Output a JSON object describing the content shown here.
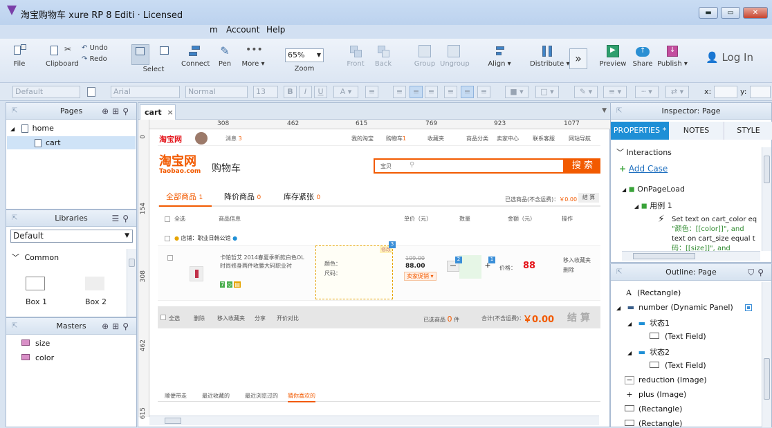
{
  "window": {
    "title": "淘宝购物车    xure RP     8         Editi     ·  Licensed",
    "controls": {
      "minimize": "▬",
      "maximize": "▭",
      "close": "✕"
    }
  },
  "menu": {
    "items": [
      "m",
      "Account",
      "Help"
    ]
  },
  "toolbar": {
    "file": "File",
    "clipboard": "Clipboard",
    "undo": "Undo",
    "redo": "Redo",
    "select": "Select",
    "connect": "Connect",
    "pen": "Pen",
    "more": "More",
    "zoom_value": "65%",
    "zoom": "Zoom",
    "front": "Front",
    "back": "Back",
    "group": "Group",
    "ungroup": "Ungroup",
    "align": "Align",
    "distribute": "Distribute",
    "preview": "Preview",
    "share": "Share",
    "publish": "Publish",
    "login": "Log In"
  },
  "format": {
    "style": "Default",
    "font": "Arial",
    "weight": "Normal",
    "size": "13",
    "x_label": "x:",
    "y_label": "y:"
  },
  "pages": {
    "title": "Pages",
    "items": [
      {
        "label": "home"
      },
      {
        "label": "cart"
      }
    ]
  },
  "libraries": {
    "title": "Libraries",
    "selected": "Default",
    "group": "Common",
    "items": [
      "Box 1",
      "Box 2"
    ]
  },
  "masters": {
    "title": "Masters",
    "items": [
      "size",
      "color"
    ]
  },
  "canvas": {
    "tab": "cart",
    "ruler_h": [
      "308",
      "462",
      "615",
      "769",
      "923",
      "1077"
    ],
    "ruler_v": [
      "0",
      "154",
      "308",
      "462",
      "615"
    ]
  },
  "design": {
    "logo": "淘宝网",
    "topbar": {
      "msg": "消息",
      "msg_count": "3",
      "links": [
        "我的淘宝",
        "购物车",
        "收藏夹",
        "商品分类",
        "卖家中心",
        "联系客服",
        "网站导航"
      ],
      "cart_count": "1"
    },
    "brand": {
      "name": "淘宝网",
      "sub": "Taobao.com",
      "page": "购物车"
    },
    "search": {
      "scope": "宝贝",
      "button": "搜 索"
    },
    "tabs": [
      {
        "label": "全部商品",
        "count": "1"
      },
      {
        "label": "降价商品",
        "count": "0"
      },
      {
        "label": "库存紧张",
        "count": "0"
      }
    ],
    "selected_info": {
      "label": "已选商品(不含运费)",
      "price": "￥0.00",
      "settle": "结 算"
    },
    "columns": [
      "全选",
      "商品信息",
      "单价（元）",
      "数量",
      "金额（元）",
      "操作"
    ],
    "shop": {
      "label": "店铺：",
      "name": "职业日韩公馆"
    },
    "item": {
      "title": "卡帕哲艾 2014春夏季新款白色OL时尚修身两件收腰大码职业衬",
      "color_label": "颜色：",
      "size_label": "尺码：",
      "edit_tag": "修改",
      "old_price": "109.00",
      "price": "88.00",
      "promo": "卖家促销",
      "qty_minus": "－",
      "qty_plus": "+",
      "price_label": "价格：",
      "total": "88",
      "ops": [
        "移入收藏夹",
        "删除"
      ],
      "badge": "3",
      "badge_num1": "2",
      "badge_num2": "1"
    },
    "footer": {
      "select_all": "全选",
      "delete": "删除",
      "move": "移入收藏夹",
      "share": "分享",
      "compare": "开价对比",
      "selected": "已选商品",
      "selected_count": "0",
      "unit": "件",
      "total_label": "合计(不含运费)：",
      "total": "￥0.00",
      "settle": "结 算"
    },
    "bottom_tabs": [
      "顺便带走",
      "最近收藏的",
      "最近浏览过的",
      "猜你喜欢的"
    ]
  },
  "inspector": {
    "title": "Inspector: Page",
    "tabs": [
      "PROPERTIES",
      "NOTES",
      "STYLE"
    ],
    "interactions": "Interactions",
    "add_case": "Add Case",
    "event": "OnPageLoad",
    "case": "用例 1",
    "action_lines": [
      "Set text on cart_color eq",
      "\"颜色：[[color]]\", and",
      "text on cart_size equal t",
      "码：[[size]]\", and"
    ]
  },
  "outline": {
    "title": "Outline: Page",
    "items": [
      {
        "label": "(Rectangle)",
        "icon": "A"
      },
      {
        "label": "number (Dynamic Panel)",
        "icon": "panel"
      },
      {
        "label": "状态1",
        "icon": "state"
      },
      {
        "label": "(Text Field)",
        "icon": "field"
      },
      {
        "label": "状态2",
        "icon": "state"
      },
      {
        "label": "(Text Field)",
        "icon": "field"
      },
      {
        "label": "reduction (Image)",
        "icon": "minus"
      },
      {
        "label": "plus (Image)",
        "icon": "plus"
      },
      {
        "label": "(Rectangle)",
        "icon": "rect"
      },
      {
        "label": "(Rectangle)",
        "icon": "rect"
      }
    ]
  },
  "colors": {
    "accent": "#f25a00",
    "taobao_red": "#e4141a",
    "tab_blue": "#1e8fd6"
  }
}
